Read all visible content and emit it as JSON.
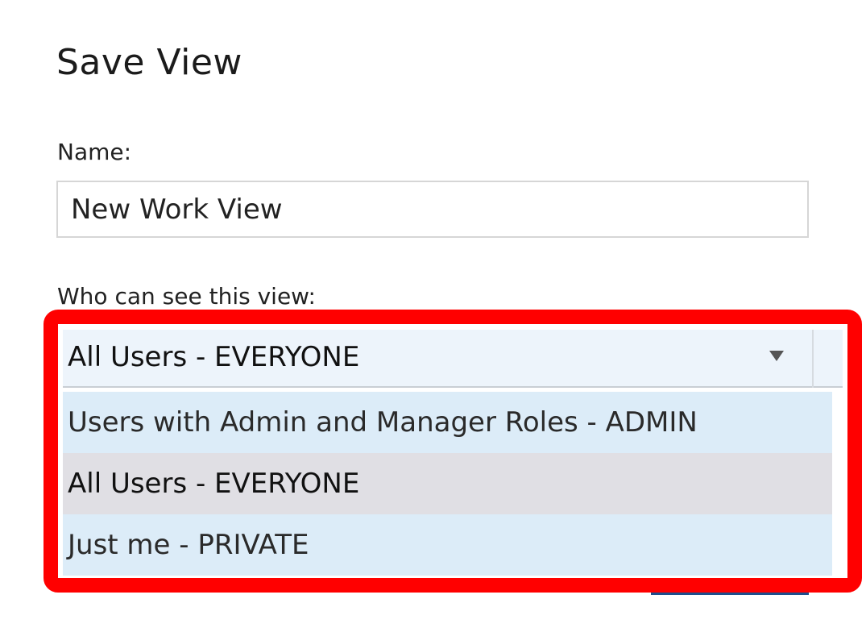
{
  "dialog": {
    "title": "Save View"
  },
  "name_field": {
    "label": "Name:",
    "value": "New Work View"
  },
  "visibility": {
    "label": "Who can see this view:",
    "selected": "All Users - EVERYONE",
    "options": [
      {
        "label": "Users with Admin and Manager Roles - ADMIN"
      },
      {
        "label": "All Users - EVERYONE"
      },
      {
        "label": "Just me - PRIVATE"
      }
    ]
  },
  "colors": {
    "highlight": "#ff0000",
    "option_background": "#dcecf8",
    "option_selected_background": "#e0dfe4",
    "select_background": "#edf4fb"
  }
}
